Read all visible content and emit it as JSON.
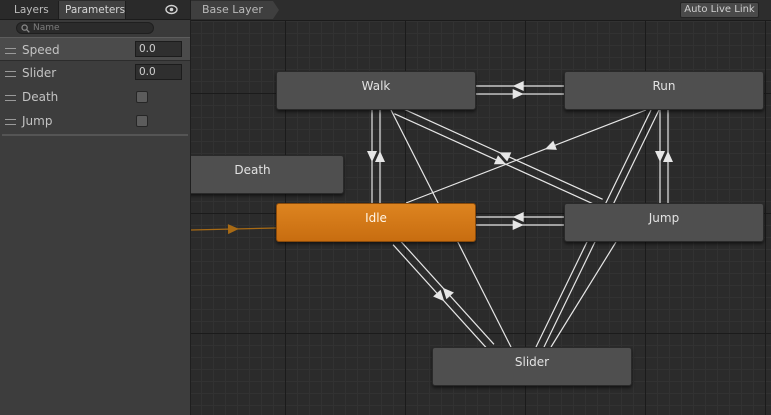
{
  "left_panel": {
    "tabs": [
      {
        "label": "Layers"
      },
      {
        "label": "Parameters"
      }
    ],
    "active_tab": "Parameters",
    "search": {
      "placeholder": "Name",
      "value": ""
    },
    "parameters": [
      {
        "name": "Speed",
        "type": "float",
        "value": "0.0",
        "selected": true
      },
      {
        "name": "Slider",
        "type": "float",
        "value": "0.0",
        "selected": false
      },
      {
        "name": "Death",
        "type": "bool",
        "value": false,
        "selected": false
      },
      {
        "name": "Jump",
        "type": "bool",
        "value": false,
        "selected": false
      }
    ]
  },
  "graph": {
    "breadcrumb": "Base Layer",
    "live_link_label": "Auto Live Link",
    "states": [
      {
        "id": "walk",
        "label": "Walk",
        "default": false
      },
      {
        "id": "run",
        "label": "Run",
        "default": false
      },
      {
        "id": "death",
        "label": "Death",
        "default": false
      },
      {
        "id": "idle",
        "label": "Idle",
        "default": true
      },
      {
        "id": "jump",
        "label": "Jump",
        "default": false
      },
      {
        "id": "slider",
        "label": "Slider",
        "default": false
      }
    ]
  },
  "colors": {
    "default_state": "#d97a16",
    "state": "#4f4f4f",
    "transition": "#e6e6e6",
    "entry_transition": "#a86a14"
  },
  "icons": [
    "eye-icon",
    "search-icon",
    "add-icon",
    "drag-handle-icon"
  ]
}
